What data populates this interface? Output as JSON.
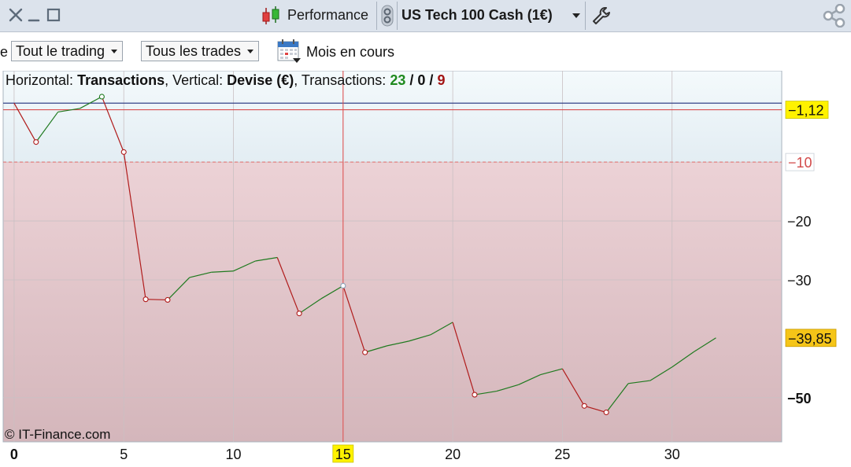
{
  "titlebar": {
    "view_label": "Performance",
    "instrument": "US Tech 100 Cash (1€)"
  },
  "toolbar": {
    "filter_trading": "Tout le trading",
    "filter_trades": "Tous les trades",
    "period_label": "Mois en cours",
    "left_cut_text": "e"
  },
  "chart_header": {
    "horizontal_label": "Horizontal:",
    "horizontal_value": "Transactions",
    "vertical_label": "Vertical:",
    "vertical_value": "Devise (€)",
    "transactions_label": "Transactions:",
    "tx_winning": "23",
    "tx_neutral": "0",
    "tx_losing": "9",
    "sep": "/"
  },
  "copyright": "© IT-Finance.com",
  "colors": {
    "up_segment": "#1f7a1f",
    "down_segment": "#b01c1c",
    "zero_line": "#1f2f7a",
    "last_value_line": "#d63a3a",
    "threshold_line": "#e06b6b",
    "current_badge": "#fff200",
    "last_badge": "#f5c518"
  },
  "chart_data": {
    "type": "line",
    "x": [
      0,
      1,
      2,
      3,
      4,
      5,
      6,
      7,
      8,
      9,
      10,
      11,
      12,
      13,
      14,
      15,
      16,
      17,
      18,
      19,
      20,
      21,
      22,
      23,
      24,
      25,
      26,
      27,
      28,
      29,
      30,
      31,
      32
    ],
    "values": [
      0,
      -6.6,
      -1.5,
      -0.9,
      1.1,
      -8.3,
      -33.3,
      -33.4,
      -29.6,
      -28.7,
      -28.5,
      -26.8,
      -26.2,
      -35.7,
      -33.2,
      -31.0,
      -42.3,
      -41.2,
      -40.4,
      -39.3,
      -37.2,
      -49.5,
      -48.9,
      -47.8,
      -46.1,
      -45.1,
      -51.4,
      -52.5,
      -47.6,
      -47.1,
      -44.8,
      -42.2,
      -39.85
    ],
    "marked_points_x": [
      1,
      4,
      5,
      6,
      7,
      13,
      15,
      16,
      21,
      26,
      27
    ],
    "xlim": [
      -0.5,
      35
    ],
    "ylim": [
      -57.5,
      5.5
    ],
    "x_ticks": [
      "0",
      "5",
      "10",
      "15",
      "20",
      "25",
      "30"
    ],
    "y_ticks": [
      "-10",
      "-20",
      "-30",
      "-50"
    ],
    "zero_level": 0,
    "threshold_level": -10,
    "current_value_label": "-1,12",
    "current_value_level": -1.12,
    "last_value_label": "-39,85",
    "last_value_level": -39.85,
    "crosshair_x_label": "15",
    "crosshair_x": 15,
    "grid": true
  }
}
